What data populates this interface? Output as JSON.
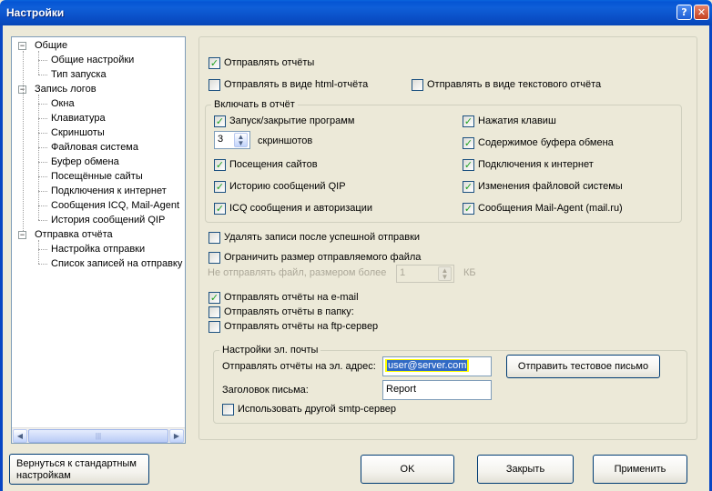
{
  "window": {
    "title": "Настройки",
    "help_label": "?",
    "close_label": "✕"
  },
  "tree": {
    "items": [
      {
        "label": "Общие",
        "level": 0,
        "expander": "⊟"
      },
      {
        "label": "Общие настройки",
        "level": 1
      },
      {
        "label": "Тип запуска",
        "level": 1
      },
      {
        "label": "Запись логов",
        "level": 0,
        "expander": "⊟"
      },
      {
        "label": "Окна",
        "level": 1
      },
      {
        "label": "Клавиатура",
        "level": 1
      },
      {
        "label": "Скриншоты",
        "level": 1
      },
      {
        "label": "Файловая система",
        "level": 1
      },
      {
        "label": "Буфер обмена",
        "level": 1
      },
      {
        "label": "Посещённые сайты",
        "level": 1
      },
      {
        "label": "Подключения к интернет",
        "level": 1
      },
      {
        "label": "Сообщения ICQ, Mail-Agent",
        "level": 1
      },
      {
        "label": "История сообщений QIP",
        "level": 1
      },
      {
        "label": "Отправка отчёта",
        "level": 0,
        "expander": "⊟"
      },
      {
        "label": "Настройка отправки",
        "level": 1
      },
      {
        "label": "Список записей на отправку",
        "level": 1
      }
    ],
    "scroll": {
      "left": "◀",
      "right": "▶",
      "grip": "|||"
    }
  },
  "report": {
    "send_reports": {
      "label": "Отправлять отчёты",
      "checked": true
    },
    "send_html": {
      "label": "Отправлять в виде html-отчёта",
      "checked": false
    },
    "send_text": {
      "label": "Отправлять в виде текстового отчёта",
      "checked": false
    },
    "include": {
      "legend": "Включать в отчёт",
      "programs": {
        "label": "Запуск/закрытие программ",
        "checked": true
      },
      "keystrokes": {
        "label": "Нажатия клавиш",
        "checked": true
      },
      "screenshots_count": "3",
      "screenshots_label": "скриншотов",
      "clipboard": {
        "label": "Содержимое буфера обмена",
        "checked": true
      },
      "sites": {
        "label": "Посещения сайтов",
        "checked": true
      },
      "internet": {
        "label": "Подключения к интернет",
        "checked": true
      },
      "qip": {
        "label": "Историю сообщений QIP",
        "checked": true
      },
      "filesystem": {
        "label": "Изменения файловой системы",
        "checked": true
      },
      "icq": {
        "label": "ICQ сообщения и авторизации",
        "checked": true
      },
      "mailagent": {
        "label": "Сообщения Mail-Agent (mail.ru)",
        "checked": true
      }
    },
    "delete_after": {
      "label": "Удалять записи после успешной отправки",
      "checked": false
    },
    "limit_size": {
      "label": "Ограничить размер отправляемого файла",
      "checked": false
    },
    "max_size_label": "Не отправлять файл, размером более",
    "max_size_value": "1",
    "max_size_unit": "КБ",
    "send_email": {
      "label": "Отправлять отчёты на e-mail",
      "checked": true
    },
    "send_folder": {
      "label": "Отправлять отчёты в папку:",
      "checked": false
    },
    "send_ftp": {
      "label": "Отправлять отчёты на ftp-сервер",
      "checked": false
    },
    "email": {
      "legend": "Настройки эл. почты",
      "address_label": "Отправлять отчёты на эл. адрес:",
      "address_value": "user@server.com",
      "test_button": "Отправить тестовое письмо",
      "subject_label": "Заголовок письма:",
      "subject_value": "Report",
      "other_smtp": {
        "label": "Использовать другой smtp-сервер",
        "checked": false
      }
    }
  },
  "buttons": {
    "reset": "Вернуться к стандартным настройкам",
    "ok": "OK",
    "close": "Закрыть",
    "apply": "Применить"
  },
  "check_mark": "✓"
}
